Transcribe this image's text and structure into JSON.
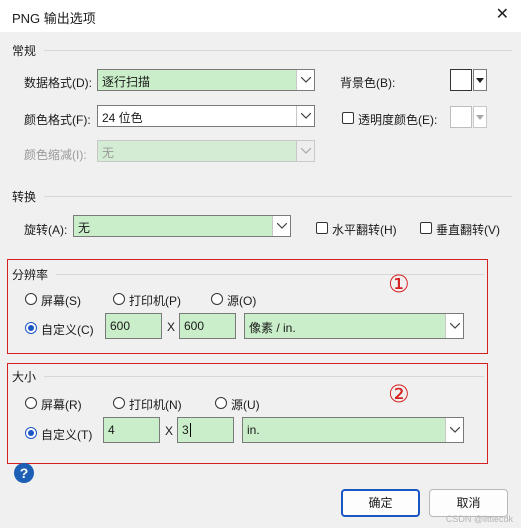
{
  "window": {
    "title": "PNG 输出选项",
    "close_glyph": "✕"
  },
  "general": {
    "heading": "常规",
    "data_format": {
      "label": "数据格式(D):",
      "value": "逐行扫描"
    },
    "color_format": {
      "label": "颜色格式(F):",
      "value": "24 位色"
    },
    "color_compress": {
      "label": "颜色缩减(I):",
      "value": "无"
    },
    "background": {
      "label": "背景色(B):"
    },
    "transparent": {
      "label": "透明度颜色(E):"
    }
  },
  "transform": {
    "heading": "转换",
    "rotate": {
      "label": "旋转(A):",
      "value": "无"
    },
    "flip_h": {
      "label": "水平翻转(H)"
    },
    "flip_v": {
      "label": "垂直翻转(V)"
    }
  },
  "resolution": {
    "heading": "分辨率",
    "screen": "屏幕(S)",
    "printer": "打印机(P)",
    "source": "源(O)",
    "custom": "自定义(C)",
    "x_value": "600",
    "y_value": "600",
    "separator": "X",
    "unit": "像素 / in.",
    "marker": "①"
  },
  "size": {
    "heading": "大小",
    "screen": "屏幕(R)",
    "printer": "打印机(N)",
    "source": "源(U)",
    "custom": "自定义(T)",
    "x_value": "4",
    "y_value": "3",
    "separator": "X",
    "unit": "in.",
    "marker": "②"
  },
  "footer": {
    "help_glyph": "?",
    "ok": "确定",
    "cancel": "取消",
    "watermark": "CSDN @littlecdk"
  },
  "colors": {
    "field_bg": "#c9eec9",
    "accent": "#1a56c4",
    "highlight": "#d62020"
  }
}
